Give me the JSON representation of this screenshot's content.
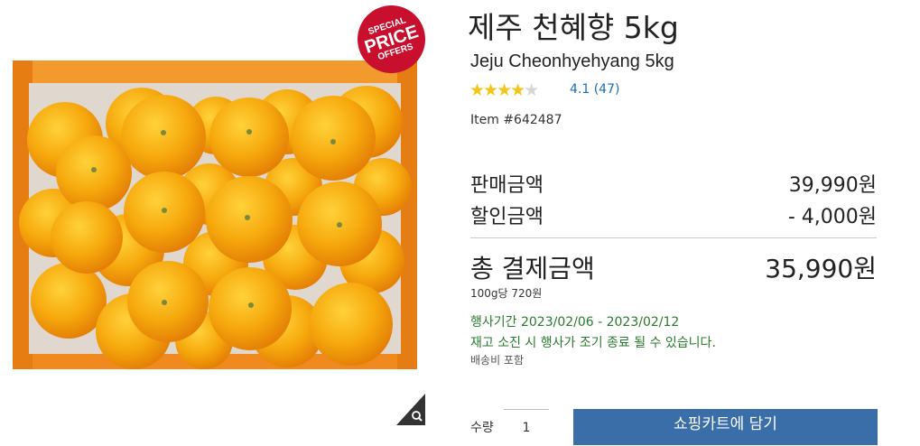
{
  "badge": {
    "line1": "SPECIAL",
    "line2": "PRICE",
    "line3": "OFFERS"
  },
  "product": {
    "title_ko": "제주 천혜향 5kg",
    "title_en": "Jeju Cheonhyehyang 5kg",
    "rating_stars": 4.1,
    "rating_text": "4.1 (47)",
    "item_number": "Item #642487"
  },
  "pricing": {
    "sale_label": "판매금액",
    "sale_value": "39,990원",
    "discount_label": "할인금액",
    "discount_value": "- 4,000원",
    "total_label": "총 결제금액",
    "total_value": "35,990원",
    "unit_price": "100g당 720원"
  },
  "promotion": {
    "period": "행사기간 2023/02/06 - 2023/02/12",
    "notice": "재고 소진 시 행사가 조기 종료 될 수 있습니다.",
    "shipping": "배송비 포함"
  },
  "purchase": {
    "quantity_label": "수량",
    "quantity_value": "1",
    "cart_button": "쇼핑카트에 담기"
  },
  "icons": [
    "zoom-icon",
    "star-icon"
  ],
  "colors": {
    "badge": "#c8102e",
    "star": "#f5c518",
    "link": "#1a6fb4",
    "promo": "#2a7a2e",
    "button": "#3a6ea8"
  }
}
